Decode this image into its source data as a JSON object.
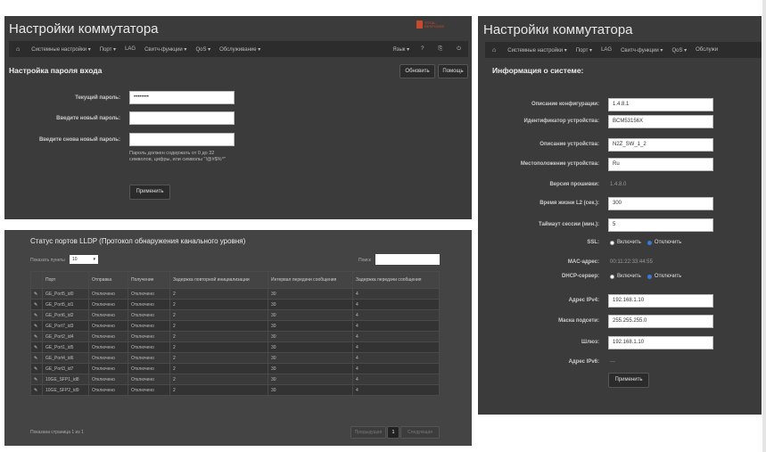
{
  "left": {
    "title": "Настройки коммутатора",
    "logo_text": "TOTAL RESPONSE",
    "nav": [
      "Системные настройки ▾",
      "Порт ▾",
      "LAG",
      "Свитч-функции ▾",
      "QoS ▾",
      "Обслуживание ▾"
    ],
    "nav_right": [
      "Язык ▾",
      "?",
      "⎘",
      "⏻"
    ],
    "section": "Настройка пароля входа",
    "refresh_btn": "Обновить",
    "help_btn": "Помощь",
    "fields": [
      {
        "label": "Текущий пароль:",
        "value": "••••••••"
      },
      {
        "label": "Введите новый пароль:",
        "value": ""
      },
      {
        "label": "Введите снова новый пароль:",
        "value": ""
      }
    ],
    "hint": "Пароль должен содержать от 0 до 32 символов, цифры, или символы \"!@#$%^\"",
    "apply": "Применить"
  },
  "lldp": {
    "title": "Статус портов LLDP (Протокол обнаружения канального уровня)",
    "show_label": "Показать пункты",
    "show_value": "10",
    "search_label": "Поиск",
    "headers": [
      "Порт",
      "Отправка",
      "Получение",
      "Задержка повторной инициализации",
      "Интервал передачи сообщения",
      "Задержка передачи сообщения"
    ],
    "rows": [
      [
        "GE_Port5_id0",
        "Отключено",
        "Отключено",
        "2",
        "30",
        "4"
      ],
      [
        "GE_Port5_id1",
        "Отключено",
        "Отключено",
        "2",
        "30",
        "4"
      ],
      [
        "GE_Port6_id2",
        "Отключено",
        "Отключено",
        "2",
        "30",
        "4"
      ],
      [
        "GE_Port7_id3",
        "Отключено",
        "Отключено",
        "2",
        "30",
        "4"
      ],
      [
        "GE_Port2_id4",
        "Отключено",
        "Отключено",
        "2",
        "30",
        "4"
      ],
      [
        "GE_Port1_id5",
        "Отключено",
        "Отключено",
        "2",
        "30",
        "4"
      ],
      [
        "GE_Port4_id6",
        "Отключено",
        "Отключено",
        "2",
        "30",
        "4"
      ],
      [
        "GE_Port3_id7",
        "Отключено",
        "Отключено",
        "2",
        "30",
        "4"
      ],
      [
        "10GE_SFP1_id8",
        "Отключено",
        "Отключено",
        "2",
        "30",
        "4"
      ],
      [
        "10GE_SFP2_id9",
        "Отключено",
        "Отключено",
        "2",
        "30",
        "4"
      ]
    ],
    "footer": "Показана страница 1 из 1",
    "prev": "Предыдущая",
    "page": "1",
    "next": "Следующая"
  },
  "right": {
    "title": "Настройки коммутатора",
    "nav": [
      "Системные настройки ▾",
      "Порт ▾",
      "LAG",
      "Свитч-функции ▾",
      "QoS ▾",
      "Обслужи"
    ],
    "section": "Информация о системе:",
    "rows": [
      {
        "label": "Описание конфигурации:",
        "value": "1.4.8.1",
        "type": "input"
      },
      {
        "label": "Идентификатор устройства:",
        "value": "BCM53156X",
        "type": "input"
      },
      {
        "label": "Описание устройства:",
        "value": "N2Z_SW_1_2",
        "type": "input"
      },
      {
        "label": "Местоположение устройства:",
        "value": "Ru",
        "type": "input"
      },
      {
        "label": "Версия прошивки:",
        "value": "1.4.8.0",
        "type": "text"
      },
      {
        "label": "Время жизни L2 (сек.):",
        "value": "300",
        "type": "input"
      },
      {
        "label": "Таймаут сессии (мин.):",
        "value": "5",
        "type": "input"
      },
      {
        "label": "SSL:",
        "on": "Включить",
        "off": "Отключить",
        "type": "radio_off"
      },
      {
        "label": "MAC-адрес:",
        "value": "00:11:22:33:44:55",
        "type": "text"
      },
      {
        "label": "DHCP-сервер:",
        "on": "Включить",
        "off": "Отключить",
        "type": "radio_off"
      },
      {
        "label": "Адрес IPv4:",
        "value": "192.168.1.10",
        "type": "input"
      },
      {
        "label": "Маска подсети:",
        "value": "255.255.255.0",
        "type": "input"
      },
      {
        "label": "Шлюз:",
        "value": "192.168.1.10",
        "type": "input"
      },
      {
        "label": "Адрес IPv6:",
        "value": "---",
        "type": "text"
      }
    ],
    "apply": "Применить"
  }
}
